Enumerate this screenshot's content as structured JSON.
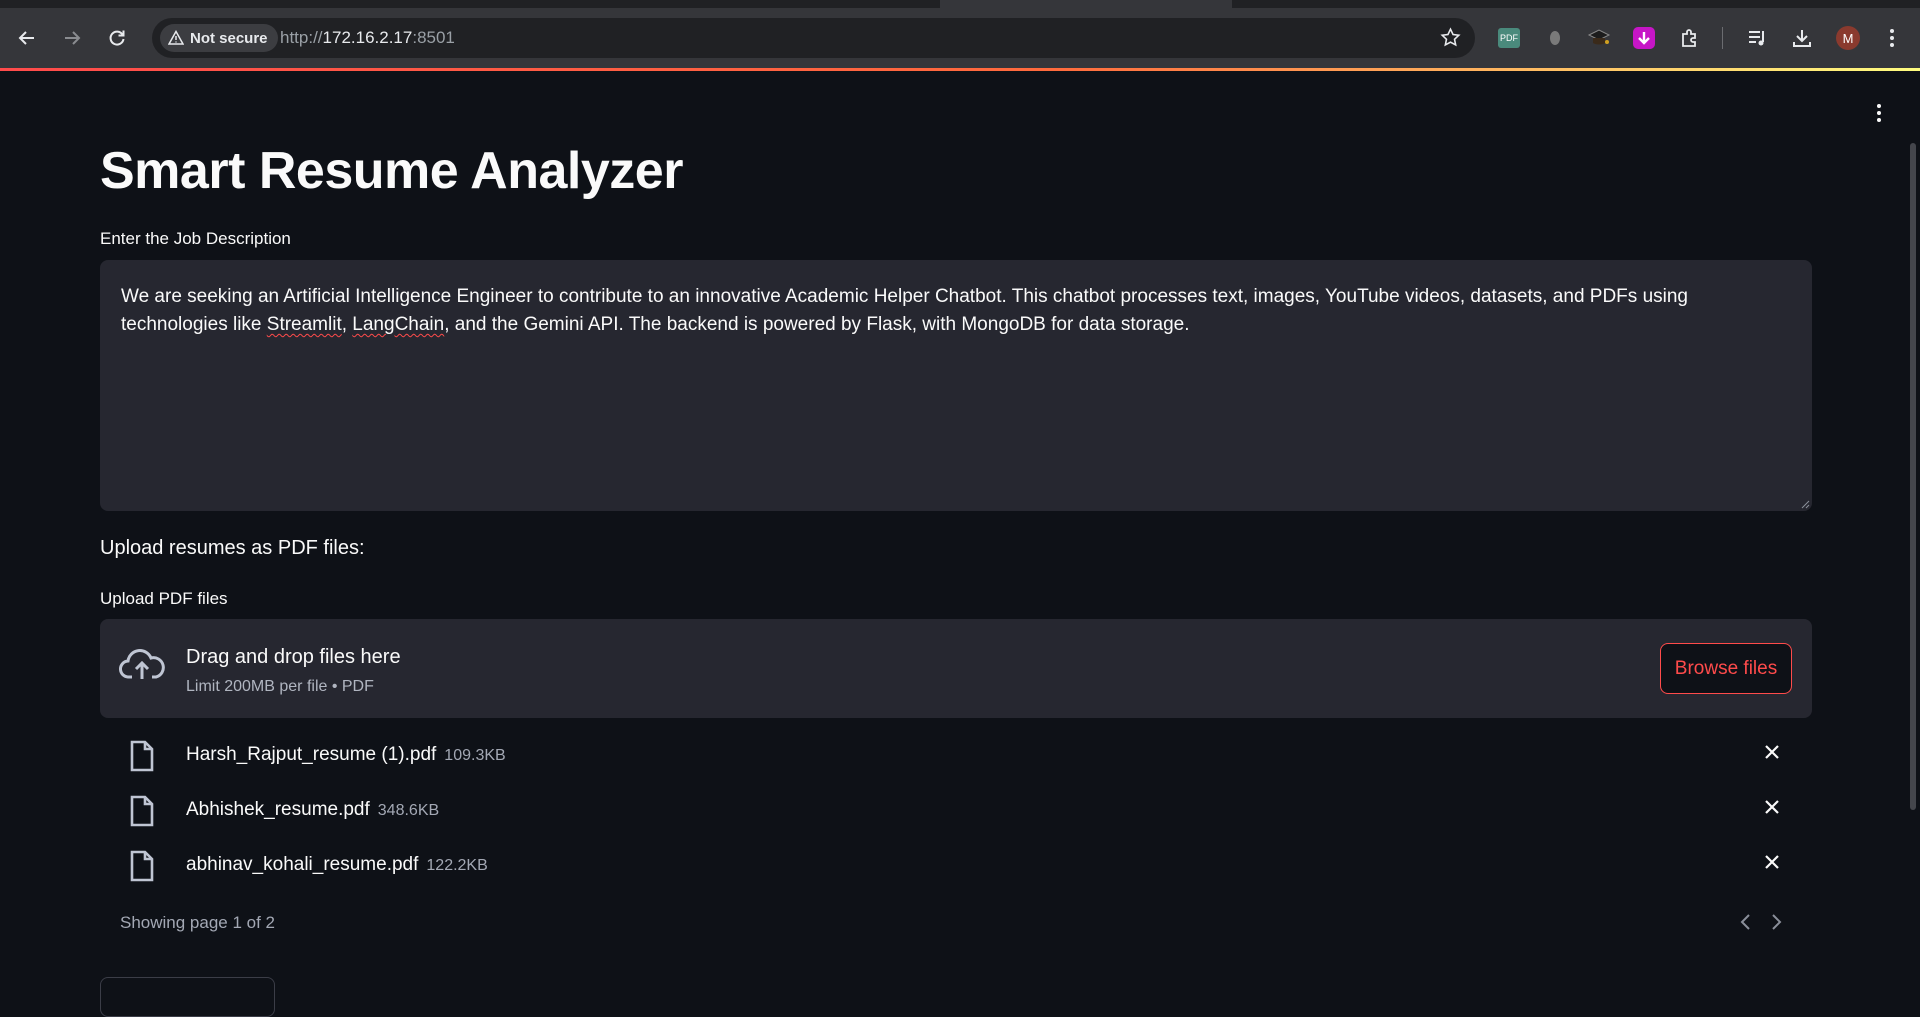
{
  "browser": {
    "security_label": "Not secure",
    "url_scheme": "http://",
    "url_host": "172.16.2.17",
    "url_port": ":8501",
    "ext_pdf_label": "PDF",
    "profile_initial": "M"
  },
  "app": {
    "title": "Smart Resume Analyzer",
    "job_description": {
      "label": "Enter the Job Description",
      "text_before": "We are seeking an Artificial Intelligence Engineer to contribute to an innovative Academic Helper Chatbot. This chatbot processes text, images, YouTube videos, datasets, and PDFs using technologies like ",
      "word_streamlit": "Streamlit",
      "comma": ", ",
      "word_langchain": "LangChain",
      "text_after": ", and the Gemini API. The backend is powered by Flask, with MongoDB for data storage."
    },
    "upload_section_text": "Upload resumes as PDF files:",
    "uploader": {
      "label": "Upload PDF files",
      "drop_title": "Drag and drop files here",
      "drop_subtitle": "Limit 200MB per file • PDF",
      "browse_label": "Browse files"
    },
    "files": [
      {
        "name": "Harsh_Rajput_resume (1).pdf",
        "size": "109.3KB"
      },
      {
        "name": "Abhishek_resume.pdf",
        "size": "348.6KB"
      },
      {
        "name": "abhinav_kohali_resume.pdf",
        "size": "122.2KB"
      }
    ],
    "pagination_text": "Showing page 1 of 2"
  },
  "colors": {
    "background": "#0e1117",
    "input_bg": "#262730",
    "accent": "#ff4b4b",
    "text": "#fafafa"
  },
  "icons": [
    "back-arrow-icon",
    "forward-arrow-icon",
    "reload-icon",
    "warning-triangle-icon",
    "star-icon",
    "kebab-menu-icon",
    "upload-cloud-icon",
    "file-icon",
    "close-icon",
    "chevron-left-icon",
    "chevron-right-icon"
  ]
}
